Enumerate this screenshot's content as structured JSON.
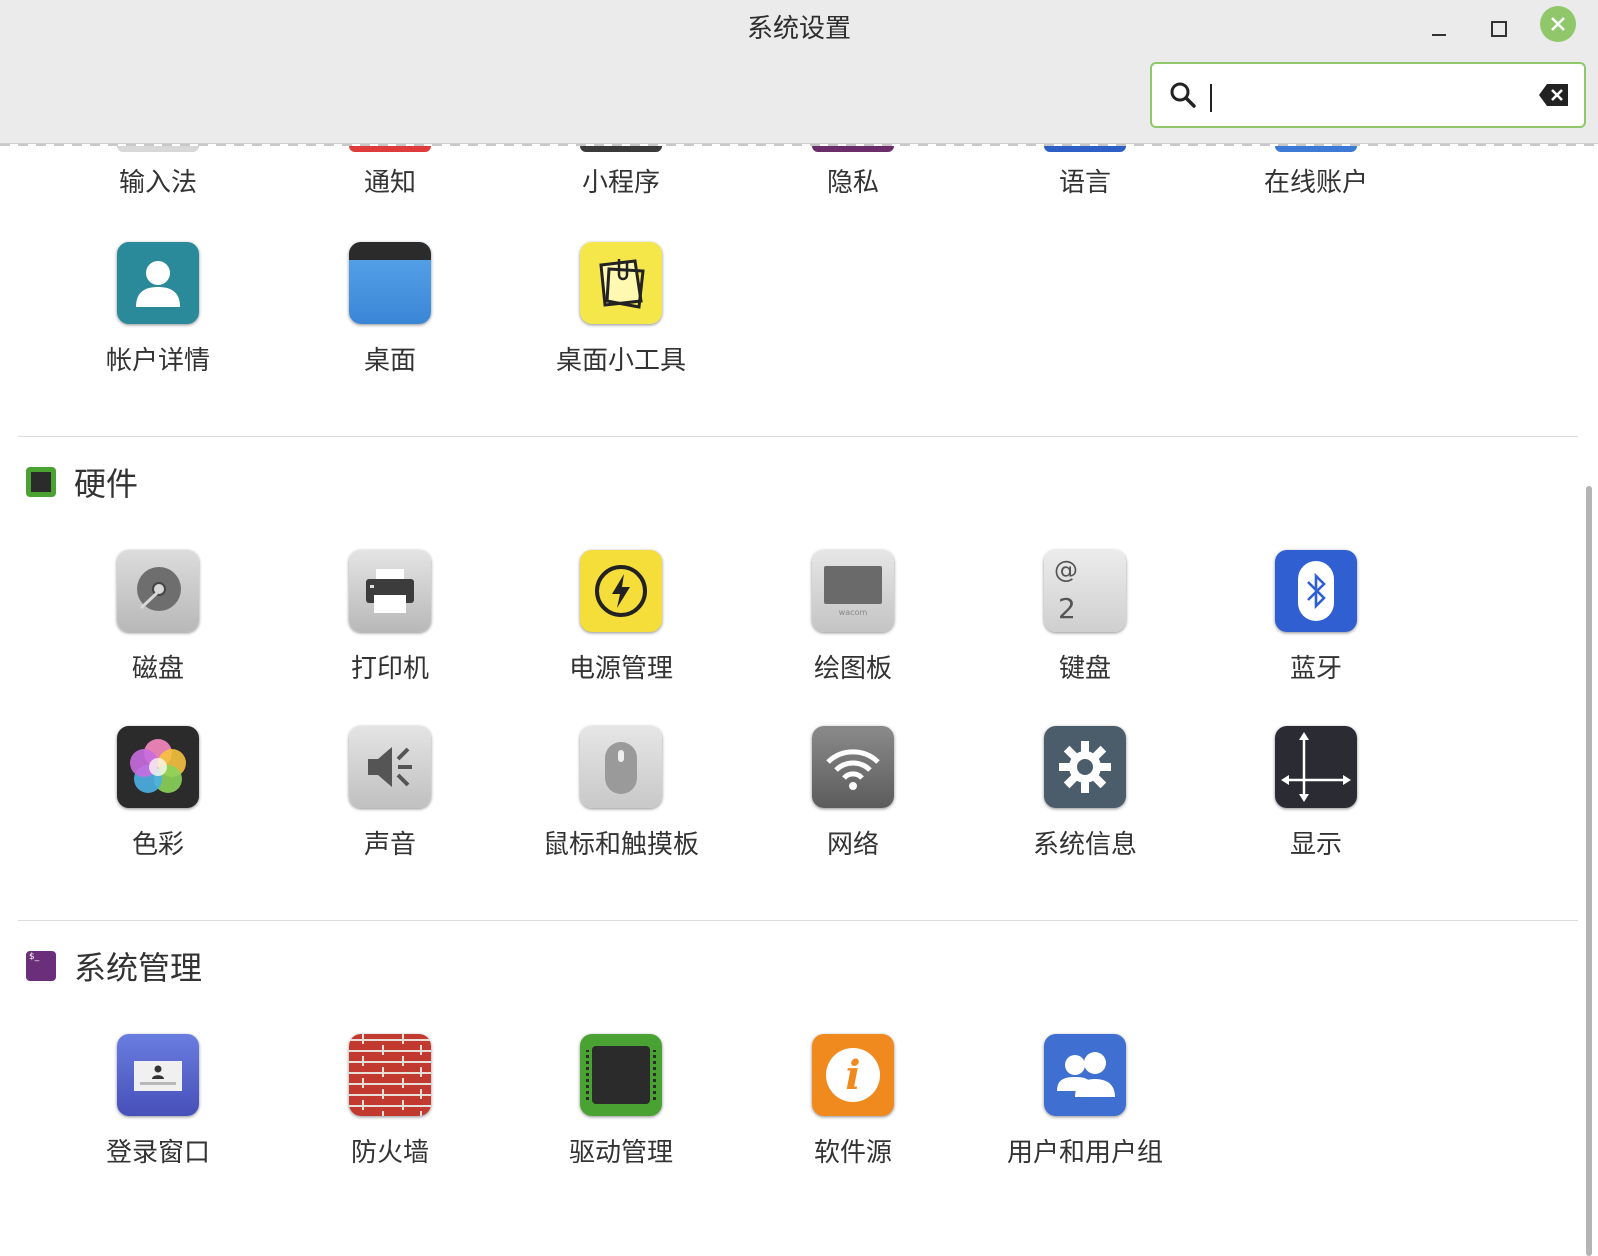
{
  "window": {
    "title": "系统设置"
  },
  "window_controls": {
    "minimize": "minimize-icon",
    "maximize": "maximize-icon",
    "close": "close-icon"
  },
  "search": {
    "value": "",
    "placeholder": "",
    "icon": "search-icon",
    "clear_icon": "clear-icon"
  },
  "colors": {
    "accent": "#8fc76a"
  },
  "personalization_partial": [
    {
      "label": "输入法",
      "icon": "input-method-icon",
      "color": "#d8d8d8"
    },
    {
      "label": "通知",
      "icon": "notification-icon",
      "color": "#e03b3b"
    },
    {
      "label": "小程序",
      "icon": "applets-icon",
      "color": "#3a3a3a"
    },
    {
      "label": "隐私",
      "icon": "privacy-icon",
      "color": "#6b2e6b"
    },
    {
      "label": "语言",
      "icon": "language-icon",
      "color": "#2d5fc4"
    },
    {
      "label": "在线账户",
      "icon": "online-accounts-icon",
      "color": "#3d7ad6"
    },
    {
      "label": "帐户详情",
      "icon": "account-details-icon"
    },
    {
      "label": "桌面",
      "icon": "desktop-icon"
    },
    {
      "label": "桌面小工具",
      "icon": "desklets-icon"
    }
  ],
  "sections": [
    {
      "title": "硬件",
      "icon": "hardware-chip-icon",
      "items": [
        {
          "label": "磁盘",
          "icon": "disks-icon"
        },
        {
          "label": "打印机",
          "icon": "printer-icon"
        },
        {
          "label": "电源管理",
          "icon": "power-icon"
        },
        {
          "label": "绘图板",
          "icon": "graphics-tablet-icon"
        },
        {
          "label": "键盘",
          "icon": "keyboard-icon"
        },
        {
          "label": "蓝牙",
          "icon": "bluetooth-icon"
        },
        {
          "label": "色彩",
          "icon": "color-icon"
        },
        {
          "label": "声音",
          "icon": "sound-icon"
        },
        {
          "label": "鼠标和触摸板",
          "icon": "mouse-icon"
        },
        {
          "label": "网络",
          "icon": "network-icon"
        },
        {
          "label": "系统信息",
          "icon": "system-info-icon"
        },
        {
          "label": "显示",
          "icon": "display-icon"
        }
      ]
    },
    {
      "title": "系统管理",
      "icon": "terminal-icon",
      "items": [
        {
          "label": "登录窗口",
          "icon": "login-window-icon"
        },
        {
          "label": "防火墙",
          "icon": "firewall-icon"
        },
        {
          "label": "驱动管理",
          "icon": "driver-manager-icon"
        },
        {
          "label": "软件源",
          "icon": "software-sources-icon"
        },
        {
          "label": "用户和用户组",
          "icon": "users-groups-icon"
        }
      ]
    }
  ],
  "icon_text": {
    "keyboard_at": "@",
    "keyboard_two": "2",
    "tablet_brand": "wacom",
    "info_i": "i",
    "terminal_prompt": "$_"
  }
}
